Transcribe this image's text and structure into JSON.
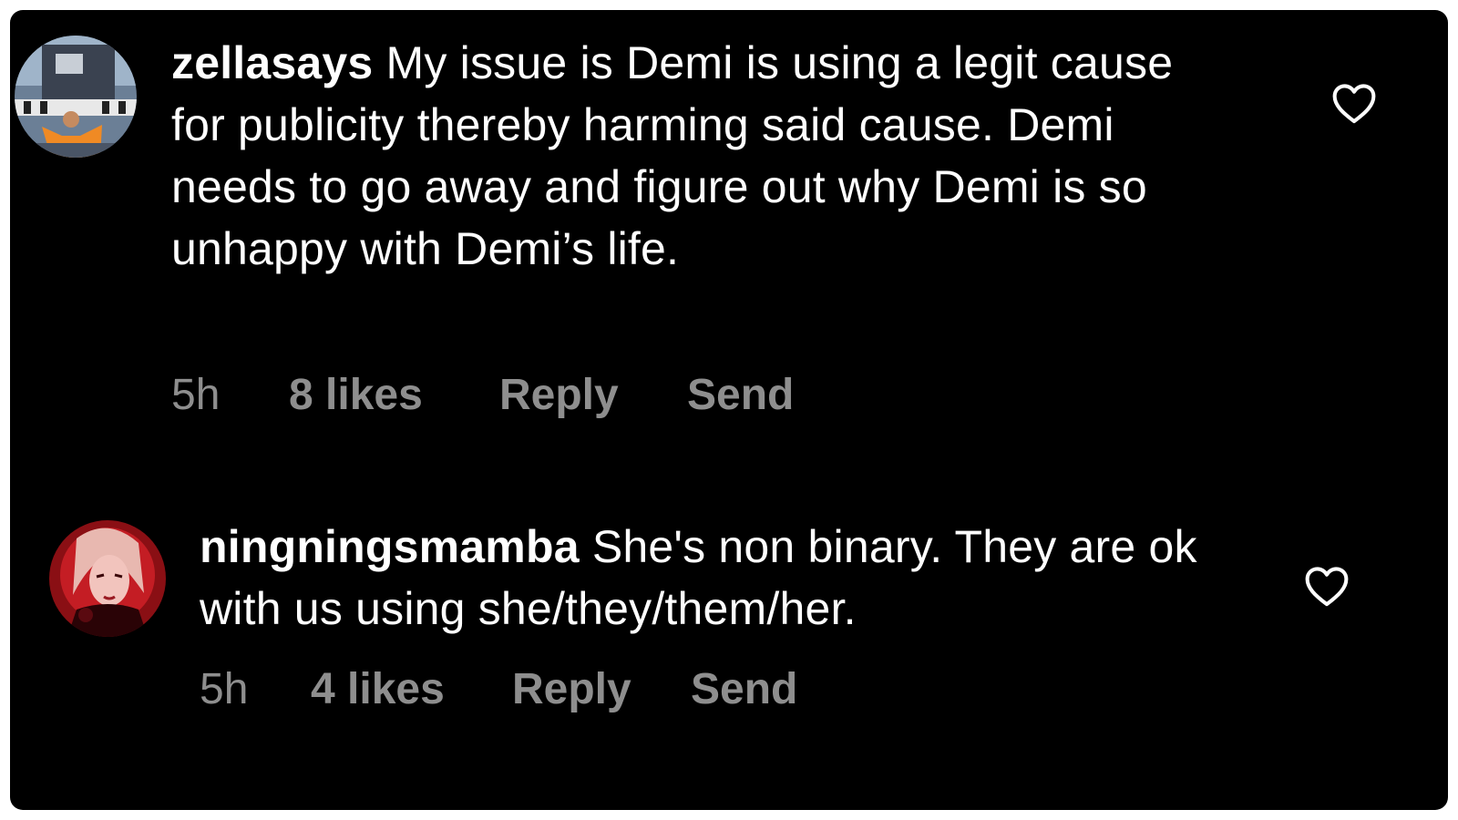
{
  "comments": [
    {
      "username": "zellasays",
      "text": "My issue is Demi is using a legit cause for publicity thereby harming said cause. Demi needs to go away and figure out why Demi is so unhappy with Demi’s life.",
      "time": "5h",
      "likes": "8 likes",
      "reply_label": "Reply",
      "send_label": "Send",
      "like_icon": "heart-outline-icon"
    },
    {
      "username": "ningningsmamba",
      "text": "She's non binary. They are ok with us using she/they/them/her.",
      "time": "5h",
      "likes": "4 likes",
      "reply_label": "Reply",
      "send_label": "Send",
      "like_icon": "heart-outline-icon"
    }
  ],
  "colors": {
    "background": "#000000",
    "text": "#ffffff",
    "meta": "#8e8e8e"
  }
}
